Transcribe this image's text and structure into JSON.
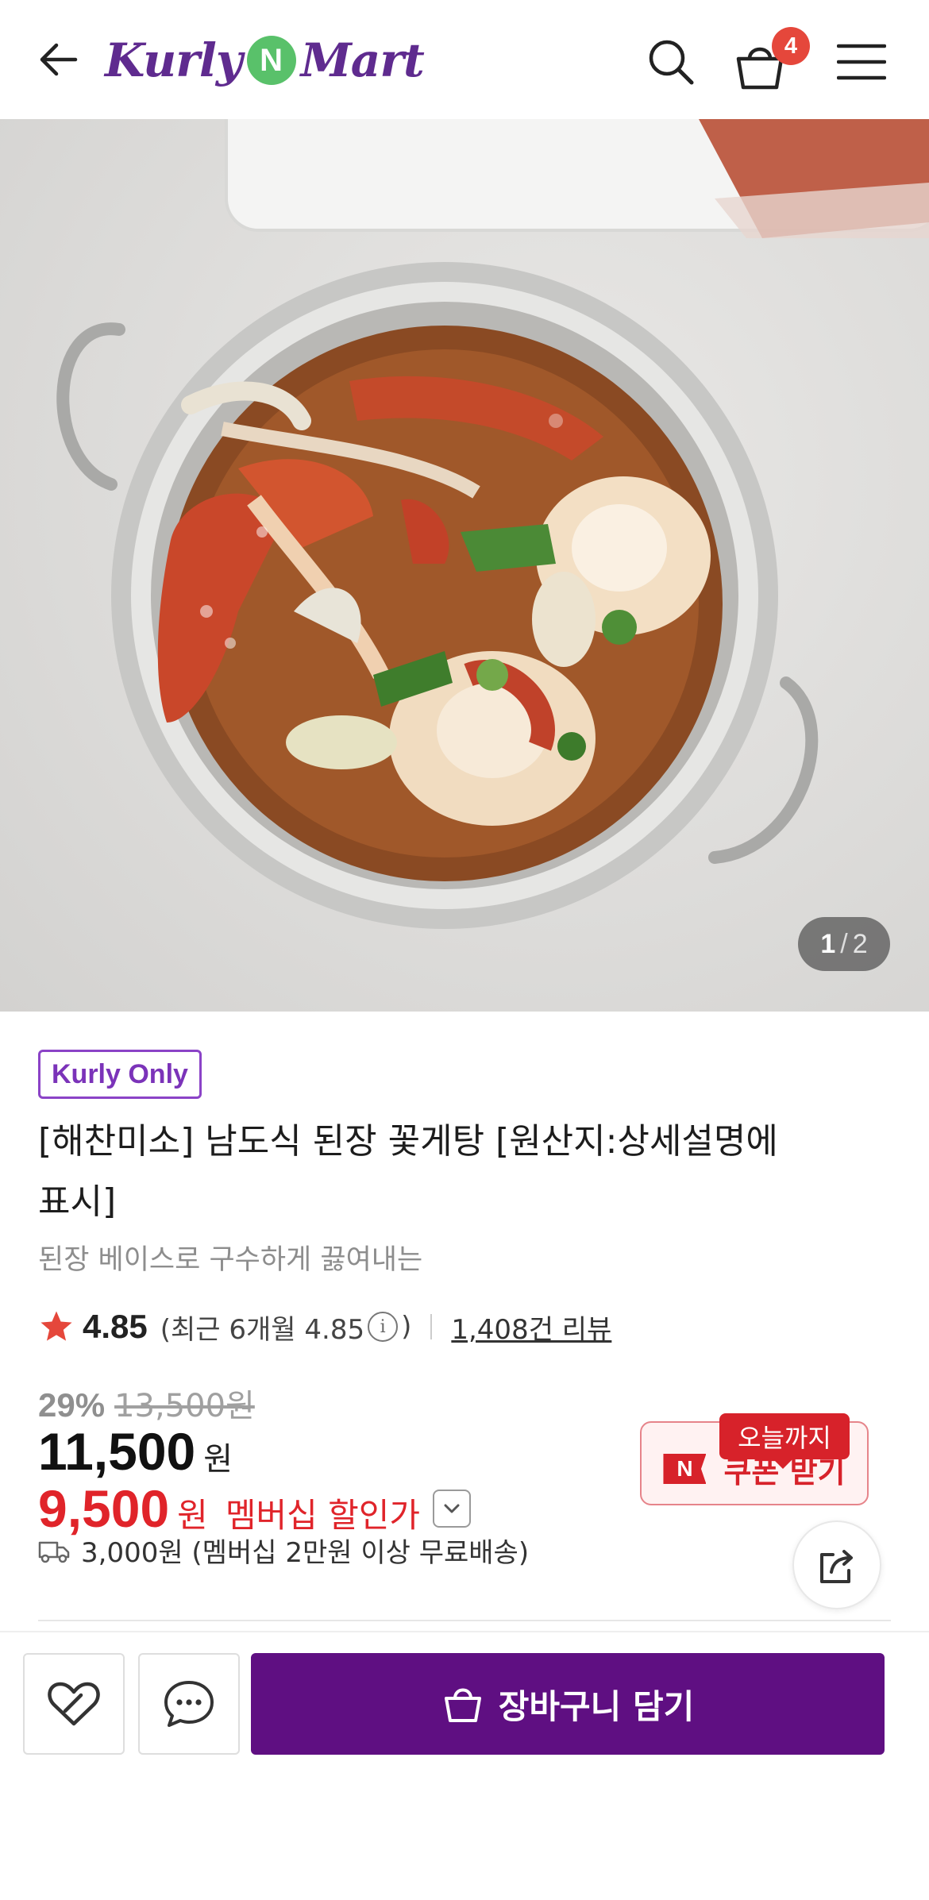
{
  "header": {
    "logo_left": "Kurly",
    "logo_mid": "N",
    "logo_right": "Mart",
    "cart_count": "4"
  },
  "gallery": {
    "current": "1",
    "total": "2"
  },
  "product": {
    "badge": "Kurly Only",
    "title_line1": "[해찬미소] 남도식 된장 꽃게탕 [원산지:상세설명에",
    "title_line2": "표시]",
    "subtitle": "된장 베이스로 구수하게 끓여내는",
    "rating": "4.85",
    "recent_open": "(최근 6개월 4.85",
    "recent_close": ")",
    "reviews": "1,408건 리뷰",
    "discount_rate": "29%",
    "original_price": "13,500원",
    "price": "11,500",
    "price_unit": "원",
    "member_price": "9,500",
    "member_unit": "원",
    "member_label": "멤버십 할인가",
    "delivery": "3,000원 (멤버십 2만원 이상 무료배송)"
  },
  "coupon": {
    "tag": "오늘까지",
    "n_mark": "N",
    "label": "쿠폰 받기"
  },
  "actions": {
    "add_to_cart": "장바구니 담기"
  },
  "colors": {
    "brand_purple": "#5f0f82",
    "logo_green": "#59c16a",
    "sale_red": "#e0242a",
    "star": "#e5473b"
  }
}
